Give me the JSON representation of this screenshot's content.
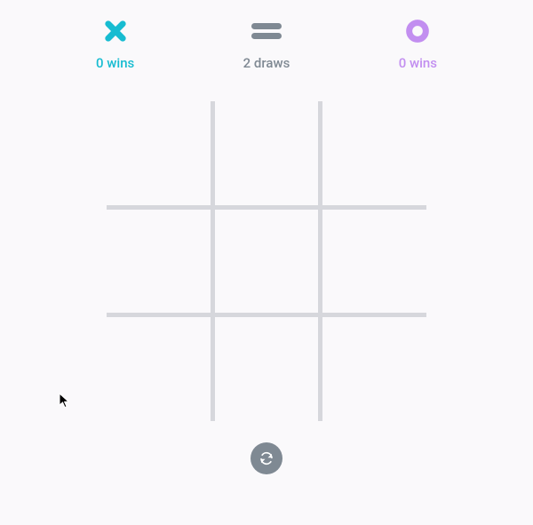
{
  "colors": {
    "x": "#17bcd1",
    "draw": "#7f8993",
    "o": "#c28ef0",
    "grid": "#d6d7dc",
    "bg": "#faf9fb"
  },
  "scores": {
    "x": {
      "value": 0,
      "label": "0 wins"
    },
    "draw": {
      "value": 2,
      "label": "2 draws"
    },
    "o": {
      "value": 0,
      "label": "0 wins"
    }
  },
  "board": {
    "cells": [
      "",
      "",
      "",
      "",
      "",
      "",
      "",
      "",
      ""
    ]
  },
  "controls": {
    "reset_label": "Reset"
  }
}
